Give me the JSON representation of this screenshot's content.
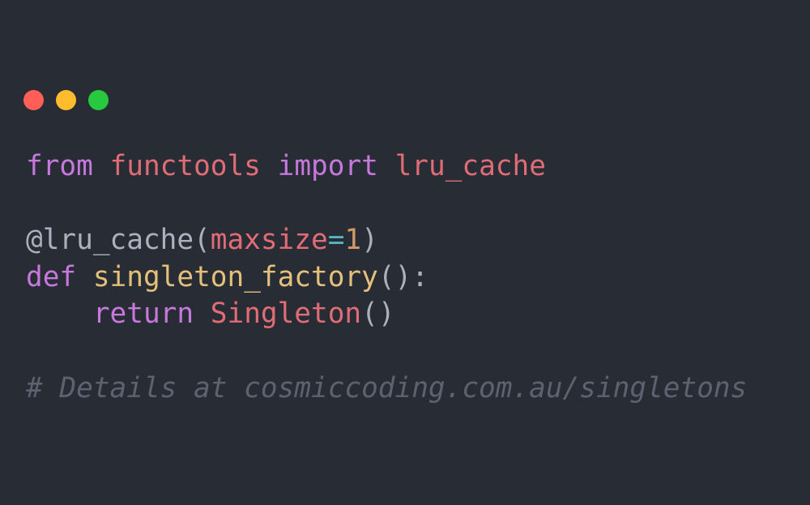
{
  "colors": {
    "background": "#282c34",
    "close": "#ff5f56",
    "minimize": "#ffbd2e",
    "maximize": "#27c93f",
    "keyword": "#c678dd",
    "identifier": "#e06c75",
    "function": "#e5c07b",
    "number": "#d19a66",
    "operator": "#56b6c2",
    "plain": "#abb2bf",
    "comment": "#5c6370"
  },
  "window_controls": [
    {
      "name": "close-button",
      "icon": "red-circle-icon"
    },
    {
      "name": "minimize-button",
      "icon": "yellow-circle-icon"
    },
    {
      "name": "maximize-button",
      "icon": "green-circle-icon"
    }
  ],
  "code": {
    "lines": [
      [
        {
          "text": "from",
          "color": "keyword"
        },
        {
          "text": " ",
          "color": "plain"
        },
        {
          "text": "functools",
          "color": "identifier"
        },
        {
          "text": " ",
          "color": "plain"
        },
        {
          "text": "import",
          "color": "keyword"
        },
        {
          "text": " ",
          "color": "plain"
        },
        {
          "text": "lru_cache",
          "color": "identifier"
        }
      ],
      [],
      [
        {
          "text": "@lru_cache(",
          "color": "plain"
        },
        {
          "text": "maxsize",
          "color": "identifier"
        },
        {
          "text": "=",
          "color": "operator"
        },
        {
          "text": "1",
          "color": "number"
        },
        {
          "text": ")",
          "color": "plain"
        }
      ],
      [
        {
          "text": "def",
          "color": "keyword"
        },
        {
          "text": " ",
          "color": "plain"
        },
        {
          "text": "singleton_factory",
          "color": "function"
        },
        {
          "text": "():",
          "color": "plain"
        }
      ],
      [
        {
          "text": "    ",
          "color": "plain"
        },
        {
          "text": "return",
          "color": "keyword"
        },
        {
          "text": " ",
          "color": "plain"
        },
        {
          "text": "Singleton",
          "color": "identifier"
        },
        {
          "text": "()",
          "color": "plain"
        }
      ],
      [],
      [
        {
          "text": "# Details at cosmiccoding.com.au/singletons",
          "color": "comment",
          "italic": true
        }
      ]
    ]
  }
}
